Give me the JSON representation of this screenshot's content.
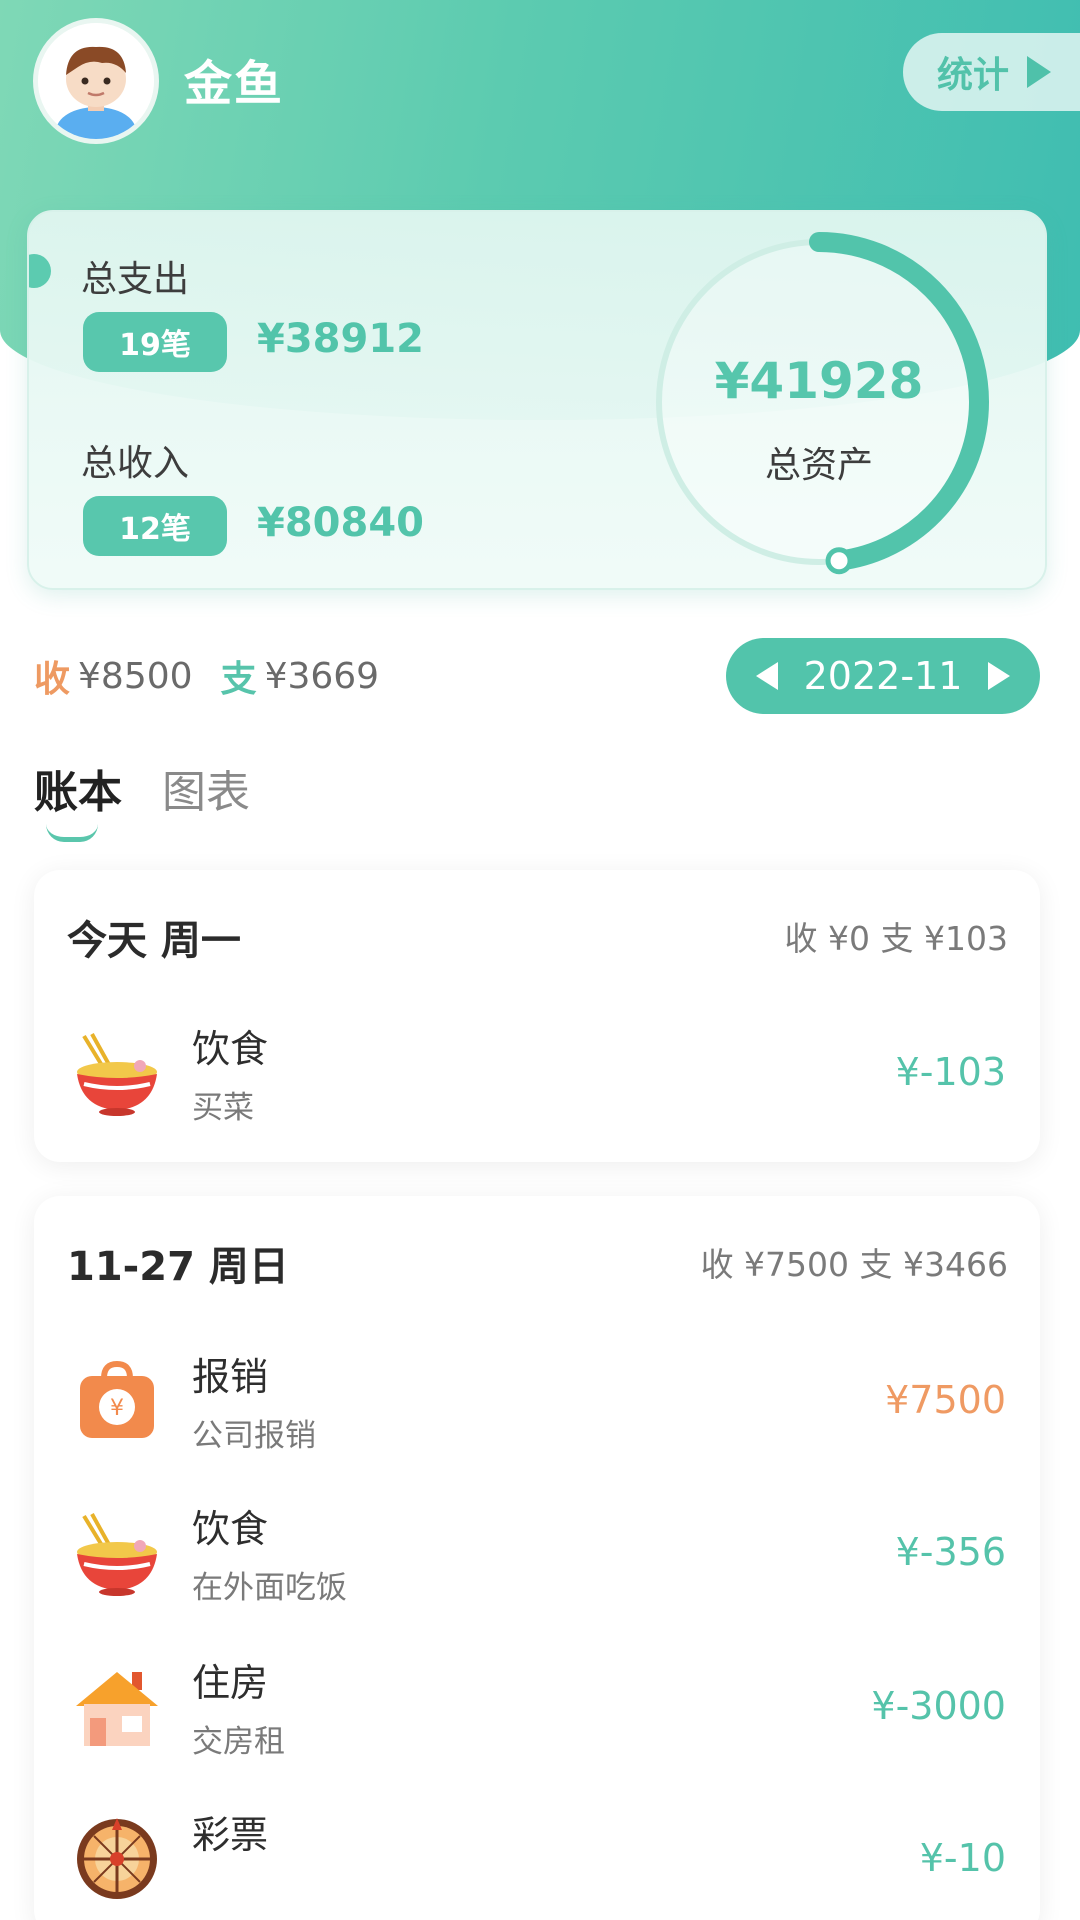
{
  "header": {
    "username": "金鱼",
    "stats_button": "统计"
  },
  "summary": {
    "expense_label": "总支出",
    "expense_count": "19笔",
    "expense_amount": "¥38912",
    "income_label": "总收入",
    "income_count": "12笔",
    "income_amount": "¥80840",
    "assets_value": "¥41928",
    "assets_label": "总资产",
    "ring_progress": 0.48
  },
  "month": {
    "income_tag": "收",
    "income_value": "¥8500",
    "expense_tag": "支",
    "expense_value": "¥3669",
    "date": "2022-11"
  },
  "tabs": [
    {
      "label": "账本",
      "active": true
    },
    {
      "label": "图表",
      "active": false
    }
  ],
  "days": [
    {
      "title": "今天 周一",
      "summary": "收 ¥0   支 ¥103",
      "entries": [
        {
          "icon": "noodle-bowl-icon",
          "name": "饮食",
          "note": "买菜",
          "amount": "¥-103",
          "type": "expense"
        }
      ]
    },
    {
      "title": "11-27 周日",
      "summary": "收 ¥7500   支 ¥3466",
      "entries": [
        {
          "icon": "reimburse-bag-icon",
          "name": "报销",
          "note": "公司报销",
          "amount": "¥7500",
          "type": "income"
        },
        {
          "icon": "noodle-bowl-icon",
          "name": "饮食",
          "note": "在外面吃饭",
          "amount": "¥-356",
          "type": "expense"
        },
        {
          "icon": "house-icon",
          "name": "住房",
          "note": "交房租",
          "amount": "¥-3000",
          "type": "expense"
        },
        {
          "icon": "lottery-wheel-icon",
          "name": "彩票",
          "note": "",
          "amount": "¥-10",
          "type": "expense"
        }
      ]
    }
  ],
  "colors": {
    "accent": "#52c4ab",
    "income": "#ef9a63",
    "expense": "#55c3aa"
  }
}
